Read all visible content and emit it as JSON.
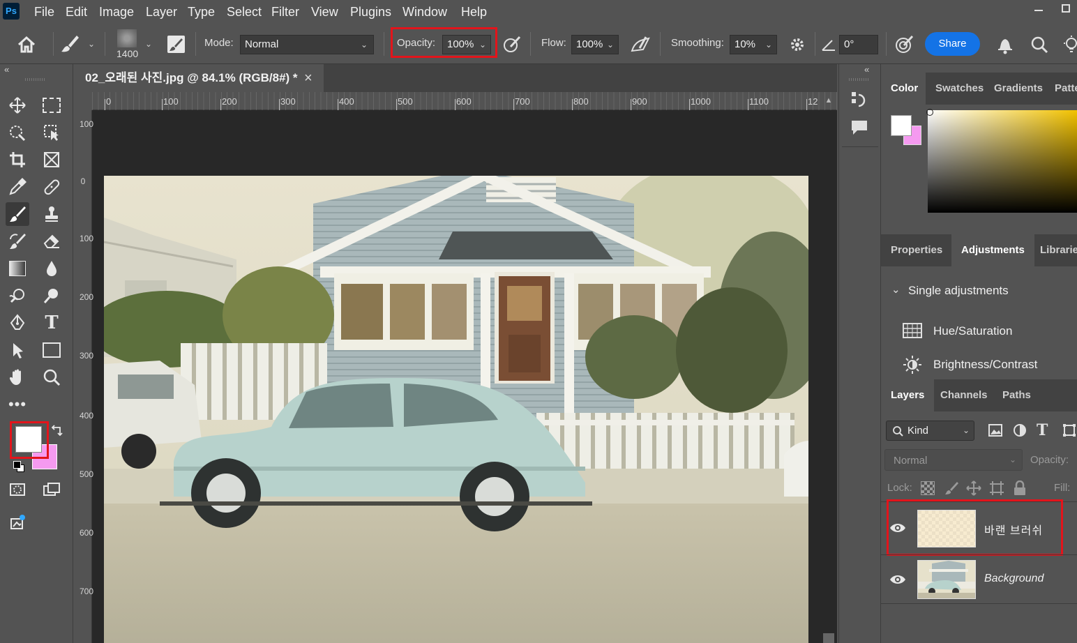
{
  "app": {
    "logo": "Ps"
  },
  "menu": [
    "File",
    "Edit",
    "Image",
    "Layer",
    "Type",
    "Select",
    "Filter",
    "View",
    "Plugins",
    "Window",
    "Help"
  ],
  "options": {
    "brush_size": "1400",
    "mode_label": "Mode:",
    "mode_value": "Normal",
    "opacity_label": "Opacity:",
    "opacity_value": "100%",
    "flow_label": "Flow:",
    "flow_value": "100%",
    "smoothing_label": "Smoothing:",
    "smoothing_value": "10%",
    "angle_value": "0°",
    "share_label": "Share"
  },
  "document": {
    "tab_title": "02_오래된 사진.jpg @ 84.1% (RGB/8#) *",
    "close": "×",
    "ruler_h": [
      "0",
      "100",
      "200",
      "300",
      "400",
      "500",
      "600",
      "700",
      "800",
      "900",
      "1000",
      "1100",
      "12"
    ],
    "ruler_v": [
      "100",
      "0",
      "100",
      "200",
      "300",
      "400",
      "500",
      "600",
      "700"
    ]
  },
  "panels": {
    "color_tabs": [
      "Color",
      "Swatches",
      "Gradients",
      "Patte"
    ],
    "props_tabs": [
      "Properties",
      "Adjustments",
      "Librarie"
    ],
    "single_adjustments": "Single adjustments",
    "adjustments": [
      "Hue/Saturation",
      "Brightness/Contrast"
    ],
    "layer_tabs": [
      "Layers",
      "Channels",
      "Paths"
    ],
    "kind_label": "Kind",
    "blend_mode": "Normal",
    "opacity_label": "Opacity:",
    "lock_label": "Lock:",
    "fill_label": "Fill:",
    "layers": [
      {
        "name": "바랜 브러쉬",
        "italic": false
      },
      {
        "name": "Background",
        "italic": true
      }
    ]
  },
  "colors": {
    "foreground": "#ffffff",
    "background": "#f59af0",
    "accent": "#1473e6",
    "highlight": "#e3141b"
  }
}
